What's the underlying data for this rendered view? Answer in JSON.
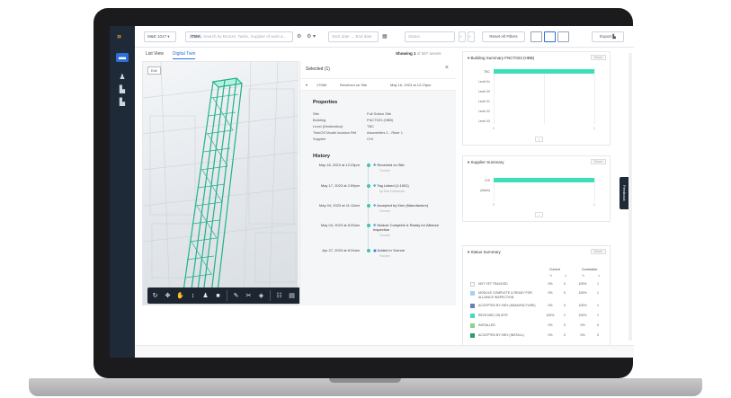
{
  "topbar": {
    "project": "M&E 1017",
    "search_tag": "ITMA",
    "search_placeholder": "Search by Bronze, Tasks, Supplier of work a...",
    "date_placeholder": "Start date → End date",
    "status_placeholder": "Status",
    "reset_label": "Reset All Filters",
    "export_label": "Export"
  },
  "tabs": [
    {
      "label": "List View"
    },
    {
      "label": "Digital Twin"
    }
  ],
  "showing": {
    "prefix": "Showing 1",
    "suffix": "of 687 assets"
  },
  "viewport": {
    "exit_label": "Exit"
  },
  "selected": {
    "header": "Selected (1)",
    "id": "17066",
    "status": "Received on Site",
    "date": "May 16, 2023 at 12:23pm"
  },
  "properties": {
    "title": "Properties",
    "rows": [
      {
        "key": "Site",
        "value": "Full Sutton Site"
      },
      {
        "key": "Building",
        "value": "FNCT023 (HBB)"
      },
      {
        "key": "Level (Destination)",
        "value": "TBC"
      },
      {
        "key": "TwinOS Model location Ref",
        "value": "Assemblies 1 - Riser 1"
      },
      {
        "key": "Supplier",
        "value": "CHI"
      }
    ]
  },
  "history": {
    "title": "History",
    "events": [
      {
        "date": "May 16, 2023 at 12:23pm",
        "event": "Received on Site",
        "by": "Yvonne"
      },
      {
        "date": "May 17, 2023 at 2:59pm",
        "event": "Tag Linked (1:1001)",
        "by": "by Dan Dunhouse"
      },
      {
        "date": "May 04, 2023 at 11:12am",
        "event": "Accepted by Kiex (Manufacture)",
        "by": "Yvonne"
      },
      {
        "date": "May 04, 2023 at 8:20am",
        "event": "Module Complete & Ready for Alliance Inspection",
        "by": "Yvonne"
      },
      {
        "date": "Apr 27, 2023 at 8:24am",
        "event": "Added to Yvonne",
        "by": "Yvonne"
      }
    ]
  },
  "building_summary": {
    "title": "Building Summary  FNCT023 (HBB)",
    "reset": "Reset",
    "levels": [
      "TBC",
      "Level 0x",
      "Level 00",
      "Level 01",
      "Level 02",
      "Level 03"
    ],
    "xlabels": [
      "0",
      "1"
    ]
  },
  "supplier_summary": {
    "title": "Supplier Summary",
    "reset": "Reset",
    "suppliers": [
      "CHI",
      "(blank)"
    ],
    "xlabels": [
      "0",
      "1"
    ]
  },
  "status_summary": {
    "title": "Status Summary",
    "reset": "Reset",
    "col_current": "Current",
    "col_cumulative": "Cumulative",
    "rows": [
      {
        "label": "NOT YET TRACKED",
        "c_pct": "0%",
        "c_n": "0",
        "t_pct": "100%",
        "t_n": "1",
        "color": "#ffffff"
      },
      {
        "label": "MODULE COMPLETE & READY FOR ALLIANCE INSPECTION",
        "c_pct": "0%",
        "c_n": "0",
        "t_pct": "100%",
        "t_n": "1",
        "color": "#9fd4f0"
      },
      {
        "label": "ACCEPTED BY KIEX (MANUFACTURE)",
        "c_pct": "0%",
        "c_n": "0",
        "t_pct": "100%",
        "t_n": "1",
        "color": "#6a7fb5"
      },
      {
        "label": "RECEIVED ON SITE",
        "c_pct": "100%",
        "c_n": "1",
        "t_pct": "100%",
        "t_n": "1",
        "color": "#3bdfb8"
      },
      {
        "label": "INSTALLED",
        "c_pct": "0%",
        "c_n": "0",
        "t_pct": "0%",
        "t_n": "0",
        "color": "#8fd08a"
      },
      {
        "label": "ACCEPTED BY KIEX (INSTALL)",
        "c_pct": "0%",
        "c_n": "0",
        "t_pct": "0%",
        "t_n": "0",
        "color": "#2a9e6a"
      }
    ]
  },
  "feedback_label": "Feedback",
  "colors": {
    "accent": "#2e6fd8",
    "teal": "#3bdfb8",
    "rail": "#1f2a38"
  }
}
